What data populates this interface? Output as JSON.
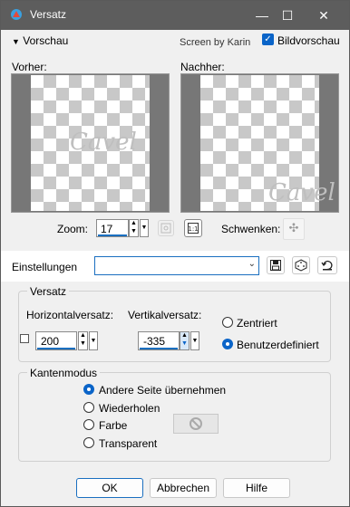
{
  "window": {
    "title": "Versatz",
    "minimize": "—",
    "maximize": "☐",
    "close": "✕"
  },
  "preview_header": {
    "toggle_label": "Vorschau",
    "credit": "Screen by Karin",
    "live_preview_label": "Bildvorschau",
    "live_preview_checked": true
  },
  "before_label": "Vorher:",
  "after_label": "Nachher:",
  "watermark_text": "Cavel",
  "zoom": {
    "label": "Zoom:",
    "value": "17"
  },
  "pan_label": "Schwenken:",
  "settings": {
    "label": "Einstellungen",
    "value": ""
  },
  "offset": {
    "group_title": "Versatz",
    "horizontal_label": "Horizontalversatz:",
    "horizontal_value": "200",
    "vertical_label": "Vertikalversatz:",
    "vertical_value": "-335",
    "centered_label": "Zentriert",
    "custom_label": "Benutzerdefiniert",
    "selected": "custom"
  },
  "edge_mode": {
    "group_title": "Kantenmodus",
    "options": [
      "Andere Seite übernehmen",
      "Wiederholen",
      "Farbe",
      "Transparent"
    ],
    "selected": "Andere Seite übernehmen"
  },
  "buttons": {
    "ok": "OK",
    "cancel": "Abbrechen",
    "help": "Hilfe"
  }
}
